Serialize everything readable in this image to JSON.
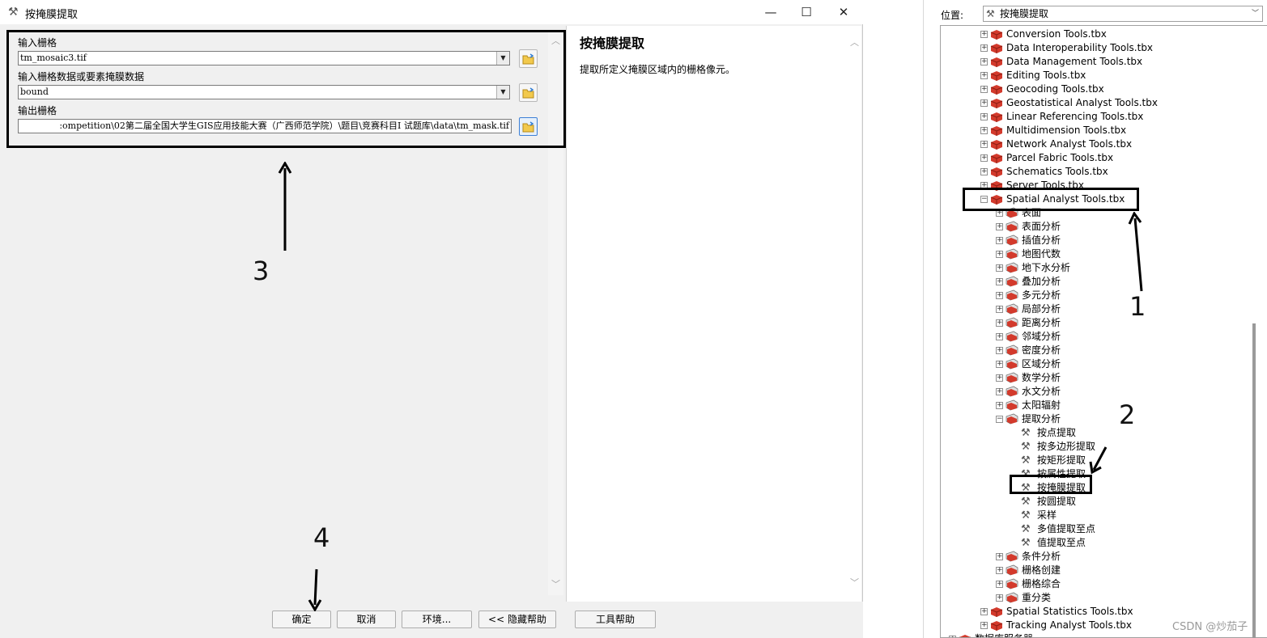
{
  "dialog": {
    "title": "按掩膜提取",
    "controls": {
      "minimize": "—",
      "maximize": "☐",
      "close": "✕"
    },
    "params": {
      "input_raster_label": "输入栅格",
      "input_raster_value": "tm_mosaic3.tif",
      "mask_label": "输入栅格数据或要素掩膜数据",
      "mask_value": "bound",
      "output_label": "输出栅格",
      "output_value": ":ompetition\\02第二届全国大学生GIS应用技能大赛（广西师范学院）\\题目\\竞赛科目I  试题库\\data\\tm_mask.tif"
    },
    "help": {
      "title": "按掩膜提取",
      "text": "提取所定义掩膜区域内的栅格像元。"
    },
    "buttons": {
      "ok": "确定",
      "cancel": "取消",
      "environments": "环境...",
      "hide_help": "<< 隐藏帮助",
      "tool_help": "工具帮助"
    }
  },
  "annotations": {
    "n1": "1",
    "n2": "2",
    "n3": "3",
    "n4": "4"
  },
  "catalog": {
    "location_label": "位置:",
    "location_value": "按掩膜提取",
    "toolboxes_top": [
      "Conversion Tools.tbx",
      "Data Interoperability Tools.tbx",
      "Data Management Tools.tbx",
      "Editing Tools.tbx",
      "Geocoding Tools.tbx",
      "Geostatistical Analyst Tools.tbx",
      "Linear Referencing Tools.tbx",
      "Multidimension Tools.tbx",
      "Network Analyst Tools.tbx",
      "Parcel Fabric Tools.tbx",
      "Schematics Tools.tbx",
      "Server Tools.tbx"
    ],
    "spatial_analyst": "Spatial Analyst Tools.tbx",
    "sa_toolsets_a": [
      "表面",
      "表面分析",
      "插值分析",
      "地图代数",
      "地下水分析",
      "叠加分析",
      "多元分析",
      "局部分析",
      "距离分析",
      "邻域分析",
      "密度分析",
      "区域分析",
      "数学分析",
      "水文分析",
      "太阳辐射"
    ],
    "extraction": "提取分析",
    "extraction_tools": [
      "按点提取",
      "按多边形提取",
      "按矩形提取",
      "按属性提取",
      "按掩膜提取",
      "按圆提取",
      "采样",
      "多值提取至点",
      "值提取至点"
    ],
    "sa_toolsets_b": [
      "条件分析",
      "栅格创建",
      "栅格综合",
      "重分类"
    ],
    "toolboxes_bottom": [
      "Spatial Statistics Tools.tbx",
      "Tracking Analyst Tools.tbx"
    ],
    "partial_last": "数据库服务器"
  },
  "watermark": "CSDN @炒茄子",
  "colors": {
    "toolbox_red": "#d33a2c",
    "annotation": "#000000",
    "highlight_blue": "#3c7fd6"
  }
}
